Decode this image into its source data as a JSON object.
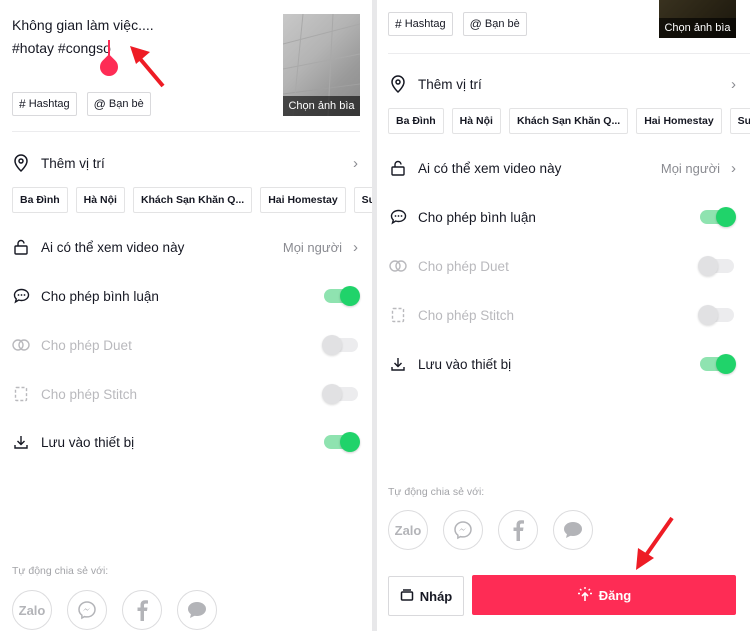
{
  "left": {
    "caption_line1": "Không gian làm việc....",
    "caption_line2": "#hotay #congso",
    "cover_label": "Chọn ảnh bìa",
    "hashtag_label": "Hashtag",
    "friends_label": "Bạn bè",
    "location_label": "Thêm vị trí",
    "location_chips": [
      "Ba Đình",
      "Hà Nội",
      "Khách Sạn Khăn Q...",
      "Hai Homestay",
      "Super"
    ],
    "privacy_label": "Ai có thể xem video này",
    "privacy_value": "Mọi người",
    "toggles": [
      {
        "label": "Cho phép bình luận",
        "on": true,
        "enabled": true
      },
      {
        "label": "Cho phép Duet",
        "on": false,
        "enabled": false
      },
      {
        "label": "Cho phép Stitch",
        "on": false,
        "enabled": false
      },
      {
        "label": "Lưu vào thiết bị",
        "on": true,
        "enabled": true
      }
    ],
    "share_label": "Tự động chia sẻ với:",
    "share_targets": [
      "Zalo",
      "Messenger",
      "Facebook",
      "Message"
    ]
  },
  "right": {
    "cover_label": "Chọn ảnh bìa",
    "hashtag_label": "Hashtag",
    "friends_label": "Bạn bè",
    "location_label": "Thêm vị trí",
    "location_chips": [
      "Ba Đình",
      "Hà Nội",
      "Khách Sạn Khăn Q...",
      "Hai Homestay",
      "Super"
    ],
    "privacy_label": "Ai có thể xem video này",
    "privacy_value": "Mọi người",
    "toggles": [
      {
        "label": "Cho phép bình luận",
        "on": true,
        "enabled": true
      },
      {
        "label": "Cho phép Duet",
        "on": false,
        "enabled": false
      },
      {
        "label": "Cho phép Stitch",
        "on": false,
        "enabled": false
      },
      {
        "label": "Lưu vào thiết bị",
        "on": true,
        "enabled": true
      }
    ],
    "share_label": "Tự động chia sẻ với:",
    "share_targets": [
      "Zalo",
      "Messenger",
      "Facebook",
      "Message"
    ],
    "draft_label": "Nháp",
    "post_label": "Đăng"
  },
  "colors": {
    "accent": "#fe2c55",
    "toggle_on": "#20d36a",
    "annotation_arrow": "#ee1c25"
  }
}
